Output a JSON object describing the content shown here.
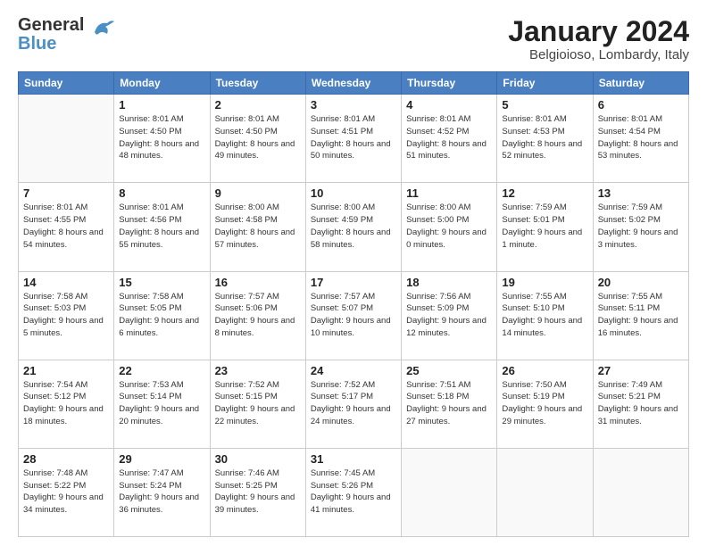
{
  "header": {
    "logo_general": "General",
    "logo_blue": "Blue",
    "month_title": "January 2024",
    "location": "Belgioioso, Lombardy, Italy"
  },
  "weekdays": [
    "Sunday",
    "Monday",
    "Tuesday",
    "Wednesday",
    "Thursday",
    "Friday",
    "Saturday"
  ],
  "weeks": [
    [
      {
        "day": "",
        "sunrise": "",
        "sunset": "",
        "daylight": ""
      },
      {
        "day": "1",
        "sunrise": "Sunrise: 8:01 AM",
        "sunset": "Sunset: 4:50 PM",
        "daylight": "Daylight: 8 hours and 48 minutes."
      },
      {
        "day": "2",
        "sunrise": "Sunrise: 8:01 AM",
        "sunset": "Sunset: 4:50 PM",
        "daylight": "Daylight: 8 hours and 49 minutes."
      },
      {
        "day": "3",
        "sunrise": "Sunrise: 8:01 AM",
        "sunset": "Sunset: 4:51 PM",
        "daylight": "Daylight: 8 hours and 50 minutes."
      },
      {
        "day": "4",
        "sunrise": "Sunrise: 8:01 AM",
        "sunset": "Sunset: 4:52 PM",
        "daylight": "Daylight: 8 hours and 51 minutes."
      },
      {
        "day": "5",
        "sunrise": "Sunrise: 8:01 AM",
        "sunset": "Sunset: 4:53 PM",
        "daylight": "Daylight: 8 hours and 52 minutes."
      },
      {
        "day": "6",
        "sunrise": "Sunrise: 8:01 AM",
        "sunset": "Sunset: 4:54 PM",
        "daylight": "Daylight: 8 hours and 53 minutes."
      }
    ],
    [
      {
        "day": "7",
        "sunrise": "Sunrise: 8:01 AM",
        "sunset": "Sunset: 4:55 PM",
        "daylight": "Daylight: 8 hours and 54 minutes."
      },
      {
        "day": "8",
        "sunrise": "Sunrise: 8:01 AM",
        "sunset": "Sunset: 4:56 PM",
        "daylight": "Daylight: 8 hours and 55 minutes."
      },
      {
        "day": "9",
        "sunrise": "Sunrise: 8:00 AM",
        "sunset": "Sunset: 4:58 PM",
        "daylight": "Daylight: 8 hours and 57 minutes."
      },
      {
        "day": "10",
        "sunrise": "Sunrise: 8:00 AM",
        "sunset": "Sunset: 4:59 PM",
        "daylight": "Daylight: 8 hours and 58 minutes."
      },
      {
        "day": "11",
        "sunrise": "Sunrise: 8:00 AM",
        "sunset": "Sunset: 5:00 PM",
        "daylight": "Daylight: 9 hours and 0 minutes."
      },
      {
        "day": "12",
        "sunrise": "Sunrise: 7:59 AM",
        "sunset": "Sunset: 5:01 PM",
        "daylight": "Daylight: 9 hours and 1 minute."
      },
      {
        "day": "13",
        "sunrise": "Sunrise: 7:59 AM",
        "sunset": "Sunset: 5:02 PM",
        "daylight": "Daylight: 9 hours and 3 minutes."
      }
    ],
    [
      {
        "day": "14",
        "sunrise": "Sunrise: 7:58 AM",
        "sunset": "Sunset: 5:03 PM",
        "daylight": "Daylight: 9 hours and 5 minutes."
      },
      {
        "day": "15",
        "sunrise": "Sunrise: 7:58 AM",
        "sunset": "Sunset: 5:05 PM",
        "daylight": "Daylight: 9 hours and 6 minutes."
      },
      {
        "day": "16",
        "sunrise": "Sunrise: 7:57 AM",
        "sunset": "Sunset: 5:06 PM",
        "daylight": "Daylight: 9 hours and 8 minutes."
      },
      {
        "day": "17",
        "sunrise": "Sunrise: 7:57 AM",
        "sunset": "Sunset: 5:07 PM",
        "daylight": "Daylight: 9 hours and 10 minutes."
      },
      {
        "day": "18",
        "sunrise": "Sunrise: 7:56 AM",
        "sunset": "Sunset: 5:09 PM",
        "daylight": "Daylight: 9 hours and 12 minutes."
      },
      {
        "day": "19",
        "sunrise": "Sunrise: 7:55 AM",
        "sunset": "Sunset: 5:10 PM",
        "daylight": "Daylight: 9 hours and 14 minutes."
      },
      {
        "day": "20",
        "sunrise": "Sunrise: 7:55 AM",
        "sunset": "Sunset: 5:11 PM",
        "daylight": "Daylight: 9 hours and 16 minutes."
      }
    ],
    [
      {
        "day": "21",
        "sunrise": "Sunrise: 7:54 AM",
        "sunset": "Sunset: 5:12 PM",
        "daylight": "Daylight: 9 hours and 18 minutes."
      },
      {
        "day": "22",
        "sunrise": "Sunrise: 7:53 AM",
        "sunset": "Sunset: 5:14 PM",
        "daylight": "Daylight: 9 hours and 20 minutes."
      },
      {
        "day": "23",
        "sunrise": "Sunrise: 7:52 AM",
        "sunset": "Sunset: 5:15 PM",
        "daylight": "Daylight: 9 hours and 22 minutes."
      },
      {
        "day": "24",
        "sunrise": "Sunrise: 7:52 AM",
        "sunset": "Sunset: 5:17 PM",
        "daylight": "Daylight: 9 hours and 24 minutes."
      },
      {
        "day": "25",
        "sunrise": "Sunrise: 7:51 AM",
        "sunset": "Sunset: 5:18 PM",
        "daylight": "Daylight: 9 hours and 27 minutes."
      },
      {
        "day": "26",
        "sunrise": "Sunrise: 7:50 AM",
        "sunset": "Sunset: 5:19 PM",
        "daylight": "Daylight: 9 hours and 29 minutes."
      },
      {
        "day": "27",
        "sunrise": "Sunrise: 7:49 AM",
        "sunset": "Sunset: 5:21 PM",
        "daylight": "Daylight: 9 hours and 31 minutes."
      }
    ],
    [
      {
        "day": "28",
        "sunrise": "Sunrise: 7:48 AM",
        "sunset": "Sunset: 5:22 PM",
        "daylight": "Daylight: 9 hours and 34 minutes."
      },
      {
        "day": "29",
        "sunrise": "Sunrise: 7:47 AM",
        "sunset": "Sunset: 5:24 PM",
        "daylight": "Daylight: 9 hours and 36 minutes."
      },
      {
        "day": "30",
        "sunrise": "Sunrise: 7:46 AM",
        "sunset": "Sunset: 5:25 PM",
        "daylight": "Daylight: 9 hours and 39 minutes."
      },
      {
        "day": "31",
        "sunrise": "Sunrise: 7:45 AM",
        "sunset": "Sunset: 5:26 PM",
        "daylight": "Daylight: 9 hours and 41 minutes."
      },
      {
        "day": "",
        "sunrise": "",
        "sunset": "",
        "daylight": ""
      },
      {
        "day": "",
        "sunrise": "",
        "sunset": "",
        "daylight": ""
      },
      {
        "day": "",
        "sunrise": "",
        "sunset": "",
        "daylight": ""
      }
    ]
  ]
}
